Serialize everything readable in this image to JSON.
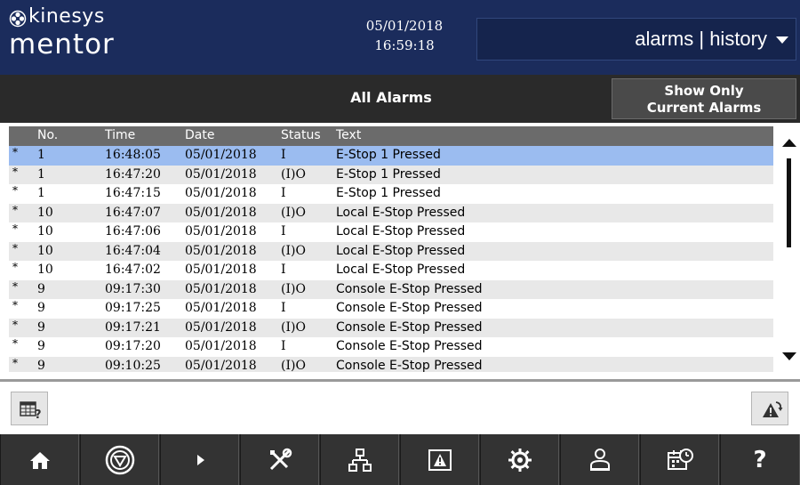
{
  "header": {
    "logo_line1": "kinesys",
    "logo_line2": "mentor",
    "date": "05/01/2018",
    "time": "16:59:18",
    "view_selector": "alarms | history"
  },
  "subheader": {
    "title": "All Alarms",
    "show_current_button": "Show Only Current Alarms",
    "show_current_line1": "Show Only",
    "show_current_line2": "Current Alarms"
  },
  "table": {
    "columns": [
      "No.",
      "Time",
      "Date",
      "Status",
      "Text"
    ],
    "rows": [
      {
        "mark": "*",
        "no": "1",
        "time": "16:48:05",
        "date": "05/01/2018",
        "status": "I",
        "text": "E-Stop 1 Pressed",
        "selected": true
      },
      {
        "mark": "*",
        "no": "1",
        "time": "16:47:20",
        "date": "05/01/2018",
        "status": "(I)O",
        "text": "E-Stop 1 Pressed"
      },
      {
        "mark": "*",
        "no": "1",
        "time": "16:47:15",
        "date": "05/01/2018",
        "status": "I",
        "text": "E-Stop 1 Pressed"
      },
      {
        "mark": "*",
        "no": "10",
        "time": "16:47:07",
        "date": "05/01/2018",
        "status": "(I)O",
        "text": "Local E-Stop Pressed"
      },
      {
        "mark": "*",
        "no": "10",
        "time": "16:47:06",
        "date": "05/01/2018",
        "status": "I",
        "text": "Local E-Stop Pressed"
      },
      {
        "mark": "*",
        "no": "10",
        "time": "16:47:04",
        "date": "05/01/2018",
        "status": "(I)O",
        "text": "Local E-Stop Pressed"
      },
      {
        "mark": "*",
        "no": "10",
        "time": "16:47:02",
        "date": "05/01/2018",
        "status": "I",
        "text": "Local E-Stop Pressed"
      },
      {
        "mark": "*",
        "no": "9",
        "time": "09:17:30",
        "date": "05/01/2018",
        "status": "(I)O",
        "text": "Console E-Stop Pressed"
      },
      {
        "mark": "*",
        "no": "9",
        "time": "09:17:25",
        "date": "05/01/2018",
        "status": "I",
        "text": "Console E-Stop Pressed"
      },
      {
        "mark": "*",
        "no": "9",
        "time": "09:17:21",
        "date": "05/01/2018",
        "status": "(I)O",
        "text": "Console E-Stop Pressed"
      },
      {
        "mark": "*",
        "no": "9",
        "time": "09:17:20",
        "date": "05/01/2018",
        "status": "I",
        "text": "Console E-Stop Pressed"
      },
      {
        "mark": "*",
        "no": "9",
        "time": "09:10:25",
        "date": "05/01/2018",
        "status": "(I)O",
        "text": "Console E-Stop Pressed"
      }
    ]
  },
  "nav": {
    "icons": [
      "home-icon",
      "estop-icon",
      "play-icon",
      "tools-icon",
      "network-icon",
      "alarm-icon",
      "gear-icon",
      "user-icon",
      "schedule-icon",
      "help-icon"
    ],
    "help_label": "?"
  },
  "colors": {
    "header_bg": "#1b2c5c",
    "subheader_bg": "#2a2a2a",
    "selected_row": "#9bbcf0",
    "alt_row": "#e8e8e8",
    "column_header": "#6b6b6b"
  }
}
